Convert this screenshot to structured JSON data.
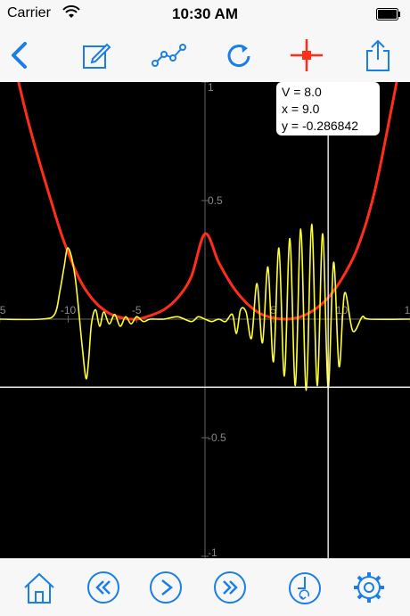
{
  "status_bar": {
    "carrier": "Carrier",
    "time": "10:30 AM"
  },
  "toolbar": {
    "icons": [
      "back-chevron-icon",
      "edit-icon",
      "graph-nodes-icon",
      "refresh-icon",
      "crosshair-icon",
      "share-icon"
    ]
  },
  "info_box": {
    "v_line": "V = 8.0",
    "x_line": " x = 9.0",
    "y_line": " y = -0.286842"
  },
  "bottom_bar": {
    "icons": [
      "home-icon",
      "rewind-icon",
      "play-icon",
      "fast-forward-icon",
      "timer-icon",
      "settings-gear-icon"
    ]
  },
  "colors": {
    "accent": "#1a7ee6",
    "red_curve": "#ff2d1a",
    "yellow_curve": "#ffff33",
    "crosshair": "#ff2d1a"
  },
  "chart_data": {
    "type": "line",
    "xlim": [
      -15,
      15
    ],
    "ylim": [
      -1,
      1
    ],
    "x_ticks": [
      {
        "value": -15,
        "label": "5"
      },
      {
        "value": -10,
        "label": "-10"
      },
      {
        "value": -5,
        "label": "-5"
      },
      {
        "value": 5,
        "label": "5"
      },
      {
        "value": 10,
        "label": "10"
      },
      {
        "value": 15,
        "label": "1"
      }
    ],
    "y_ticks": [
      {
        "value": 1,
        "label": "1"
      },
      {
        "value": 0.5,
        "label": "0.5"
      },
      {
        "value": -0.5,
        "label": "-0.5"
      },
      {
        "value": -1,
        "label": "-1"
      }
    ],
    "cursor": {
      "x": 9.0,
      "y": -0.286842
    },
    "series": [
      {
        "color": "red",
        "x": [
          -15,
          -13,
          -11,
          -10,
          -9,
          -8,
          -7,
          -6,
          -5,
          -4,
          -3,
          -2,
          -1,
          0,
          1,
          2,
          3,
          4,
          5,
          6,
          7,
          8,
          9,
          10,
          11,
          12,
          13,
          15
        ],
        "y": [
          1.35,
          0.85,
          0.45,
          0.28,
          0.15,
          0.07,
          0.025,
          0.005,
          0.0,
          0.015,
          0.04,
          0.09,
          0.18,
          0.36,
          0.24,
          0.14,
          0.07,
          0.025,
          0.005,
          0.0,
          0.01,
          0.04,
          0.09,
          0.17,
          0.28,
          0.45,
          0.7,
          1.3
        ]
      },
      {
        "color": "yellow",
        "x": [
          -15,
          -12,
          -11,
          -10.6,
          -10.3,
          -10,
          -9.5,
          -9,
          -8.7,
          -8.5,
          -8.3,
          -8,
          -7.7,
          -7.4,
          -7,
          -6.6,
          -6.2,
          -5.8,
          -5.4,
          -5,
          -4.5,
          -4,
          -3,
          -2,
          -1,
          -0.5,
          0,
          0.5,
          1,
          1.5,
          2,
          2.3,
          2.6,
          3,
          3.4,
          3.8,
          4.2,
          4.6,
          5,
          5.4,
          5.8,
          6.2,
          6.6,
          7,
          7.4,
          7.8,
          8.2,
          8.6,
          9,
          9.4,
          9.8,
          10.2,
          10.8,
          11.5,
          12,
          15
        ],
        "y": [
          0,
          0,
          0.02,
          0.12,
          0.22,
          0.3,
          0.18,
          -0.1,
          -0.25,
          -0.17,
          -0.02,
          0.04,
          -0.03,
          0.03,
          -0.02,
          0.02,
          -0.03,
          0.01,
          -0.02,
          0.01,
          -0.01,
          0.0,
          0.0,
          0.01,
          -0.01,
          0.01,
          0.0,
          -0.01,
          0.0,
          -0.01,
          0.02,
          -0.06,
          0.04,
          0.03,
          -0.08,
          0.15,
          -0.1,
          0.22,
          -0.18,
          0.3,
          -0.24,
          0.34,
          -0.28,
          0.38,
          -0.3,
          0.4,
          -0.28,
          0.36,
          -0.29,
          0.24,
          -0.2,
          0.11,
          -0.05,
          0.01,
          0.0,
          0.0
        ]
      }
    ]
  }
}
